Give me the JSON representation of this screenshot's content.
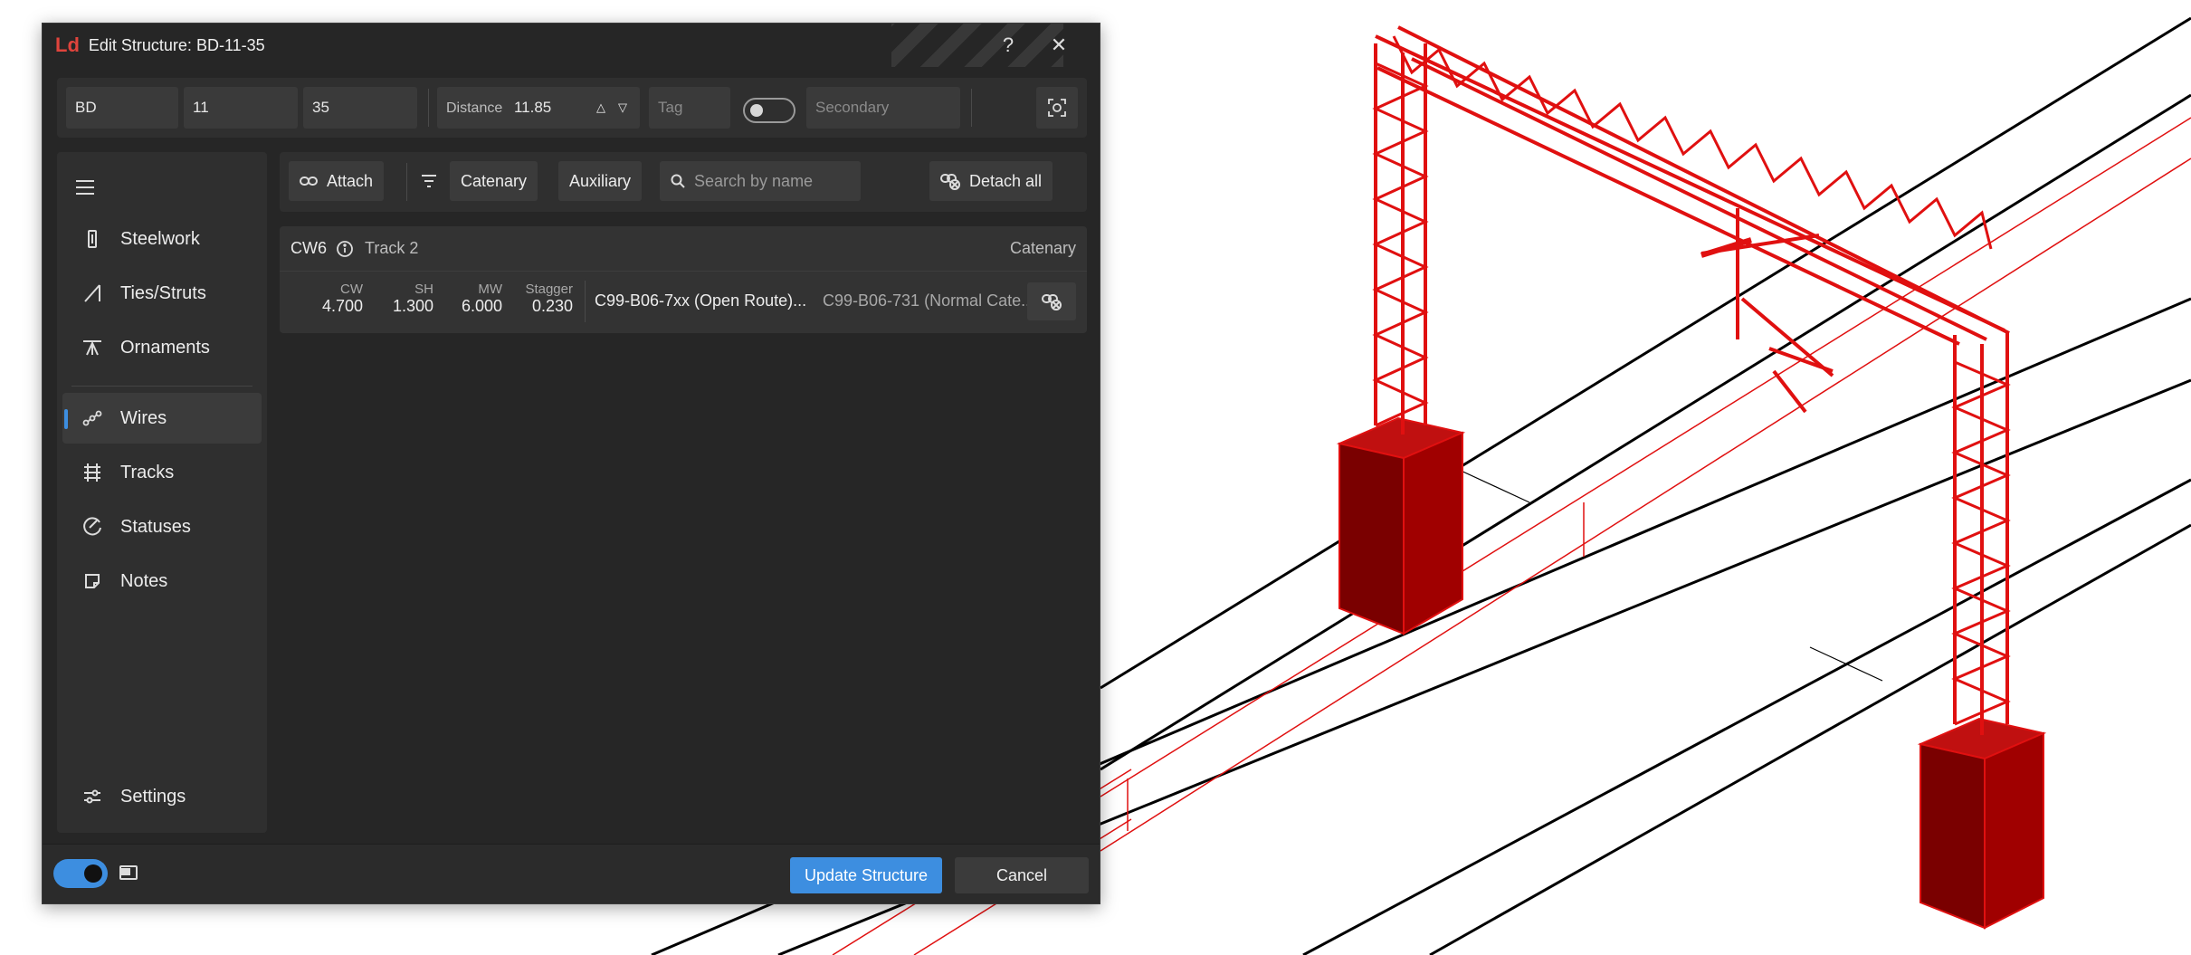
{
  "dialog": {
    "logo": "Ld",
    "title": "Edit Structure: BD-11-35",
    "help_label": "?",
    "close_label": "✕"
  },
  "top": {
    "field1": "BD",
    "field2": "11",
    "field3": "35",
    "distance_label": "Distance",
    "distance_value": "11.85",
    "tag_placeholder": "Tag",
    "secondary_placeholder": "Secondary"
  },
  "sidebar": {
    "items": [
      {
        "label": "Steelwork",
        "icon": "steelwork-icon"
      },
      {
        "label": "Ties/Struts",
        "icon": "ties-struts-icon"
      },
      {
        "label": "Ornaments",
        "icon": "ornaments-icon"
      },
      {
        "label": "Wires",
        "icon": "wires-icon",
        "active": true
      },
      {
        "label": "Tracks",
        "icon": "tracks-icon"
      },
      {
        "label": "Statuses",
        "icon": "statuses-icon"
      },
      {
        "label": "Notes",
        "icon": "notes-icon"
      }
    ],
    "settings_label": "Settings"
  },
  "toolbar": {
    "attach_label": "Attach",
    "catenary_label": "Catenary",
    "auxiliary_label": "Auxiliary",
    "search_placeholder": "Search by name",
    "detach_all_label": "Detach all"
  },
  "wire": {
    "id": "CW6",
    "track": "Track 2",
    "type": "Catenary",
    "stats": [
      {
        "key": "CW",
        "value": "4.700"
      },
      {
        "key": "SH",
        "value": "1.300"
      },
      {
        "key": "MW",
        "value": "6.000"
      },
      {
        "key": "Stagger",
        "value": "0.230"
      }
    ],
    "ref1": "C99-B06-7xx (Open Route)...",
    "ref2": "C99-B06-731 (Normal Cate..."
  },
  "footer": {
    "update_label": "Update Structure",
    "cancel_label": "Cancel"
  },
  "colors": {
    "accent": "#3d8ee0",
    "logo": "#e0443c",
    "structure": "#e01010"
  }
}
